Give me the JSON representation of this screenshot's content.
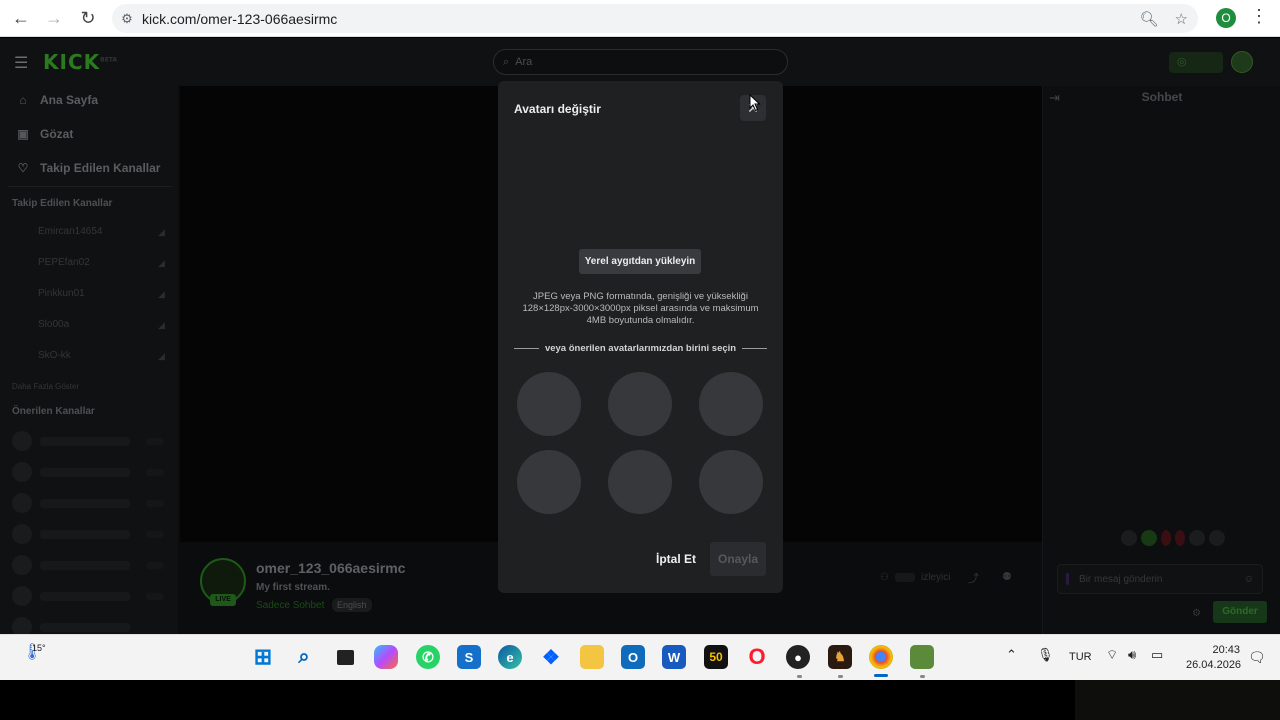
{
  "browser": {
    "url": "kick.com/omer-123-066aesirmc",
    "profile_initial": "O"
  },
  "kick": {
    "logo": "KICK",
    "logo_sup": "BETA",
    "search_placeholder": "Ara",
    "nav": [
      {
        "label": "Ana Sayfa",
        "icon": "home-icon"
      },
      {
        "label": "Gözat",
        "icon": "browse-icon"
      },
      {
        "label": "Takip Edilen Kanallar",
        "icon": "heart-icon"
      }
    ],
    "followed_heading": "Takip Edilen Kanallar",
    "followed_channels": [
      "Emircan14654",
      "PEPEfan02",
      "Pinkkun01",
      "Slo00a",
      "SkO-kk"
    ],
    "show_more": "Daha Fazla Göster",
    "recommended_heading": "Önerilen Kanallar",
    "chat_title": "Sohbet",
    "chat_placeholder": "Bir mesaj gönderin",
    "send_label": "Gönder",
    "channel": {
      "name": "omer_123_066aesirmc",
      "title": "My first stream.",
      "tag_mode": "Sadece Sohbet",
      "tag_lang": "English",
      "live": "LIVE",
      "viewers_label": "izleyici"
    }
  },
  "modal": {
    "title": "Avatarı değiştir",
    "upload_label": "Yerel aygıtdan yükleyin",
    "description": "JPEG veya PNG formatında, genişliği ve yüksekliği 128×128px-3000×3000px piksel arasında ve maksimum 4MB boyutunda olmalıdır.",
    "separator": "veya önerilen avatarlarımızdan birini seçin",
    "cancel_label": "İptal Et",
    "confirm_label": "Onayla"
  },
  "taskbar": {
    "temperature": "15°",
    "language": "TUR",
    "time": "20:43",
    "date": "26.04.2026"
  },
  "colors": {
    "kick_green": "#53fc18",
    "modal_bg": "#1f2022"
  }
}
